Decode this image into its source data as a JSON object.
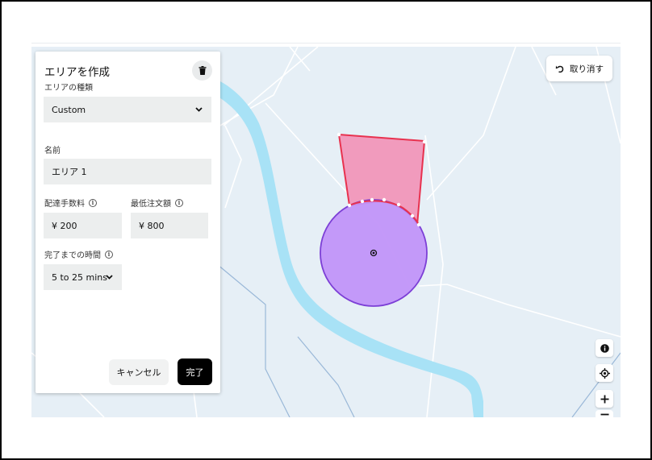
{
  "panel": {
    "title": "エリアを作成",
    "area_type_label": "エリアの種類",
    "area_type_value": "Custom",
    "name_label": "名前",
    "name_value": "エリア 1",
    "delivery_fee_label": "配達手数料",
    "delivery_fee_value": "¥ 200",
    "min_order_label": "最低注文額",
    "min_order_value": "¥ 800",
    "time_label": "完了までの時間",
    "time_value": "5 to 25 mins",
    "cancel_label": "キャンセル",
    "done_label": "完了"
  },
  "map": {
    "undo_label": "取り消す",
    "icons": [
      "trash-icon",
      "chevron-down-icon",
      "info-icon",
      "undo-icon",
      "locate-icon",
      "zoom-in-icon",
      "zoom-out-icon"
    ],
    "colors": {
      "water": "#a8e2f6",
      "land": "#e6eff6",
      "polygon_fill": "#f19bbd",
      "polygon_stroke": "#e8324f",
      "circle_fill": "#c194f9",
      "circle_stroke": "#7c3fd6"
    }
  }
}
